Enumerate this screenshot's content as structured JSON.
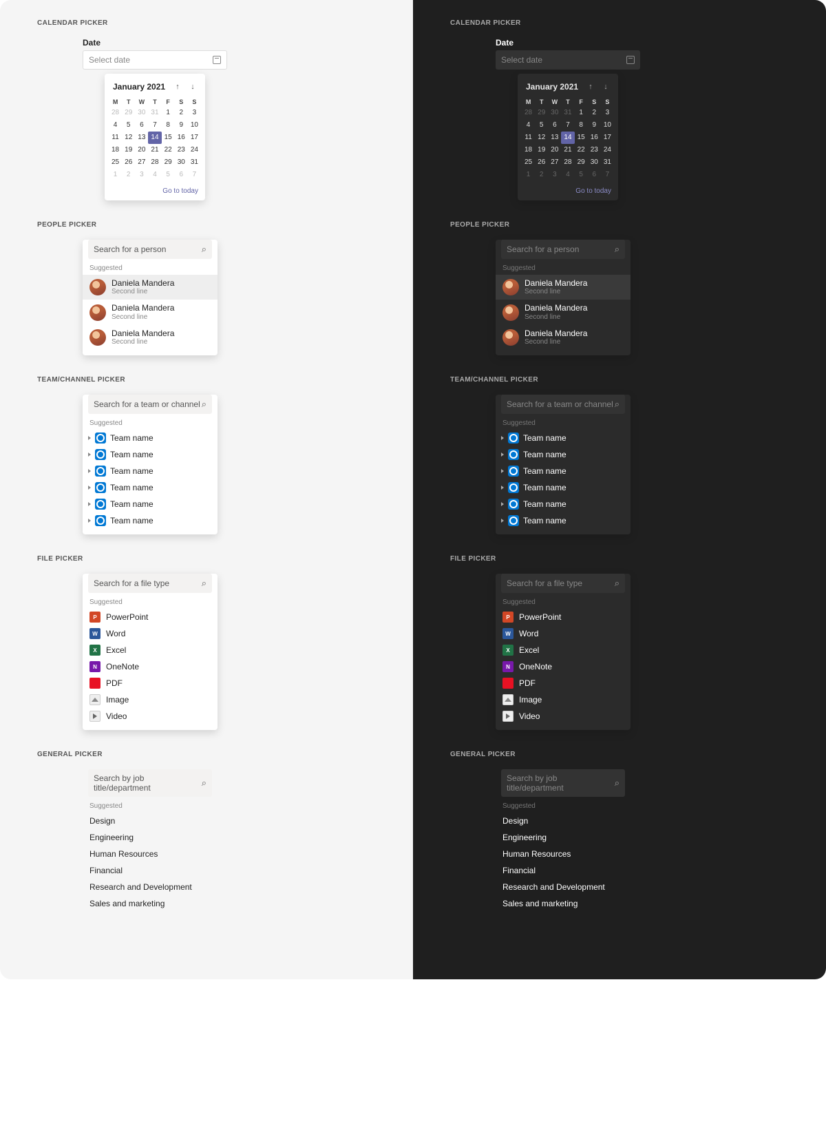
{
  "sections": {
    "calendar": "CALENDAR PICKER",
    "people": "PEOPLE PICKER",
    "team": "TEAM/CHANNEL PICKER",
    "file": "FILE PICKER",
    "general": "GENERAL PICKER"
  },
  "suggested_label": "Suggested",
  "date": {
    "label": "Date",
    "placeholder": "Select date"
  },
  "calendar": {
    "title": "January 2021",
    "goto": "Go to today",
    "dow": [
      "M",
      "T",
      "W",
      "T",
      "F",
      "S",
      "S"
    ],
    "weeks": [
      [
        {
          "d": 28,
          "out": true
        },
        {
          "d": 29,
          "out": true
        },
        {
          "d": 30,
          "out": true
        },
        {
          "d": 31,
          "out": true
        },
        {
          "d": 1
        },
        {
          "d": 2
        },
        {
          "d": 3
        }
      ],
      [
        {
          "d": 4
        },
        {
          "d": 5
        },
        {
          "d": 6
        },
        {
          "d": 7
        },
        {
          "d": 8
        },
        {
          "d": 9
        },
        {
          "d": 10
        }
      ],
      [
        {
          "d": 11
        },
        {
          "d": 12
        },
        {
          "d": 13
        },
        {
          "d": 14,
          "sel": true
        },
        {
          "d": 15
        },
        {
          "d": 16
        },
        {
          "d": 17
        }
      ],
      [
        {
          "d": 18
        },
        {
          "d": 19
        },
        {
          "d": 20
        },
        {
          "d": 21
        },
        {
          "d": 22
        },
        {
          "d": 23
        },
        {
          "d": 24
        }
      ],
      [
        {
          "d": 25
        },
        {
          "d": 26
        },
        {
          "d": 27
        },
        {
          "d": 28
        },
        {
          "d": 29
        },
        {
          "d": 30
        },
        {
          "d": 31
        }
      ],
      [
        {
          "d": 1,
          "out": true
        },
        {
          "d": 2,
          "out": true
        },
        {
          "d": 3,
          "out": true
        },
        {
          "d": 4,
          "out": true
        },
        {
          "d": 5,
          "out": true
        },
        {
          "d": 6,
          "out": true
        },
        {
          "d": 7,
          "out": true
        }
      ]
    ]
  },
  "people": {
    "placeholder": "Search for a person",
    "items": [
      {
        "name": "Daniela Mandera",
        "sub": "Second line",
        "sel": true
      },
      {
        "name": "Daniela Mandera",
        "sub": "Second line"
      },
      {
        "name": "Daniela Mandera",
        "sub": "Second line"
      }
    ]
  },
  "team": {
    "placeholder": "Search for a team or channel",
    "items": [
      "Team name",
      "Team name",
      "Team name",
      "Team name",
      "Team name",
      "Team name"
    ]
  },
  "file": {
    "placeholder": "Search for a file type",
    "items": [
      {
        "label": "PowerPoint",
        "t": "pp",
        "g": "P"
      },
      {
        "label": "Word",
        "t": "wd",
        "g": "W"
      },
      {
        "label": "Excel",
        "t": "xl",
        "g": "X"
      },
      {
        "label": "OneNote",
        "t": "on",
        "g": "N"
      },
      {
        "label": "PDF",
        "t": "pdf",
        "g": ""
      },
      {
        "label": "Image",
        "t": "img",
        "g": ""
      },
      {
        "label": "Video",
        "t": "vid",
        "g": ""
      }
    ]
  },
  "general": {
    "placeholder": "Search by job title/department",
    "items": [
      "Design",
      "Engineering",
      "Human Resources",
      "Financial",
      "Research and Development",
      "Sales and marketing"
    ]
  }
}
